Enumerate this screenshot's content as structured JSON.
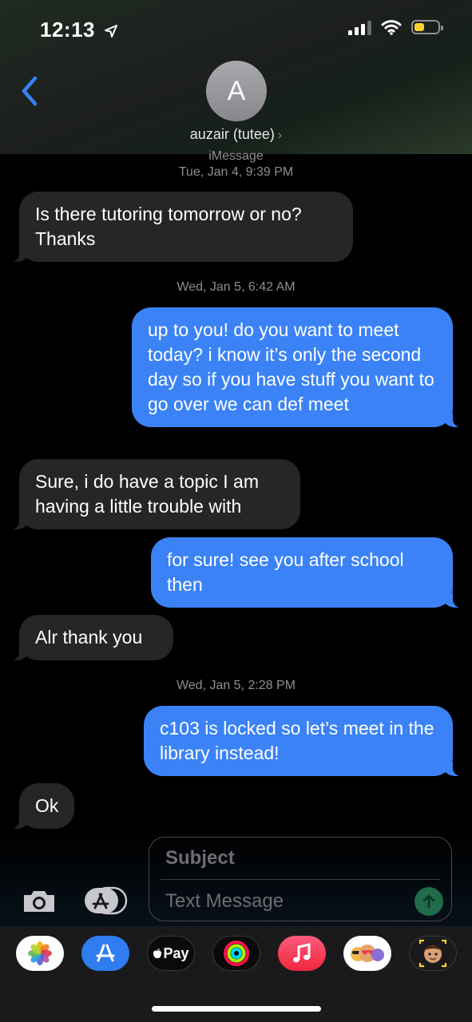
{
  "status_bar": {
    "time": "12:13",
    "battery_color": "#f5d430"
  },
  "header": {
    "avatar_initial": "A",
    "contact_name": "auzair (tutee)",
    "chevron": "›"
  },
  "thread": {
    "service_label": "iMessage",
    "messages_meta": [
      {
        "timestamp": "Tue, Jan 4, 9:39 PM"
      },
      {
        "timestamp": "Wed, Jan 5, 6:42 AM"
      },
      {
        "timestamp": "Wed, Jan 5, 2:28 PM"
      }
    ],
    "messages": [
      {
        "dir": "in",
        "text": "Is there tutoring tomorrow or no? Thanks"
      },
      {
        "dir": "out",
        "text": "up to you! do you want to meet today? i know it’s only the second day so if you have stuff you want to go over we can def meet"
      },
      {
        "dir": "in",
        "text": "Sure, i do have a topic I am having a little trouble with"
      },
      {
        "dir": "out",
        "text": "for sure! see you after school then"
      },
      {
        "dir": "in",
        "text": "Alr thank you"
      },
      {
        "dir": "out",
        "text": "c103 is locked so let’s meet in the library instead!"
      },
      {
        "dir": "in",
        "text": "Ok"
      }
    ],
    "colors": {
      "incoming": "#262628",
      "outgoing": "#3a82f6"
    }
  },
  "composer": {
    "subject_placeholder": "Subject",
    "text_placeholder": "Text Message"
  },
  "app_strip": {
    "apps": [
      {
        "name": "photos-app-icon"
      },
      {
        "name": "app-store-app-icon"
      },
      {
        "name": "apple-pay-app-icon",
        "label": "Pay"
      },
      {
        "name": "activity-app-icon"
      },
      {
        "name": "music-app-icon"
      },
      {
        "name": "memoji-stickers-app-icon"
      },
      {
        "name": "animoji-app-icon"
      }
    ]
  }
}
